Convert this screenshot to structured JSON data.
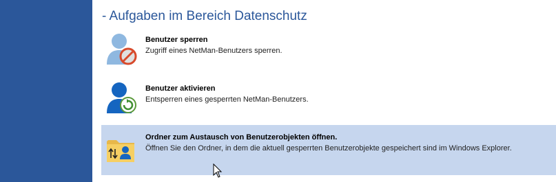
{
  "section": {
    "title": "- Aufgaben im Bereich Datenschutz"
  },
  "tasks": [
    {
      "title": "Benutzer sperren",
      "description": "Zugriff eines NetMan-Benutzers sperren.",
      "icon": "user-lock-icon"
    },
    {
      "title": "Benutzer aktivieren",
      "description": "Entsperren eines gesperrten NetMan-Benutzers.",
      "icon": "user-activate-icon"
    },
    {
      "title": "Ordner zum Austausch von Benutzerobjekten öffnen.",
      "description": "Öffnen Sie den Ordner, in dem die aktuell gesperrten Benutzerobjekte gespeichert sind im Windows Explorer.",
      "icon": "folder-exchange-icon",
      "selected": true
    }
  ],
  "colors": {
    "sidebar": "#2b579a",
    "title": "#2b579a",
    "selection": "#c6d6ee",
    "user_light": "#8fb8e0",
    "user_dark": "#1565c0"
  }
}
